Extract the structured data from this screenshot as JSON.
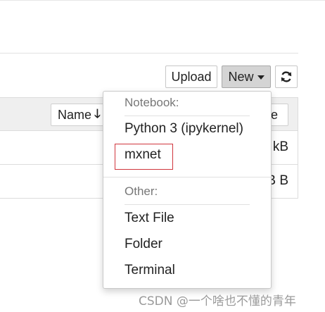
{
  "toolbar": {
    "upload_label": "Upload",
    "new_label": "New",
    "refresh_icon": "refresh-icon"
  },
  "file_list": {
    "header": {
      "name_label": "Name",
      "sort_icon": "arrow-down-icon",
      "last_modified_label_visible": "te"
    },
    "rows": [
      {
        "size": "kB"
      },
      {
        "size": "B B"
      }
    ]
  },
  "new_menu": {
    "notebook_header": "Notebook:",
    "notebook_items": [
      "Python 3 (ipykernel)",
      "mxnet"
    ],
    "other_header": "Other:",
    "other_items": [
      "Text File",
      "Folder",
      "Terminal"
    ],
    "highlight_color": "#d0353d"
  },
  "watermark": "CSDN @一个啥也不懂的青年"
}
